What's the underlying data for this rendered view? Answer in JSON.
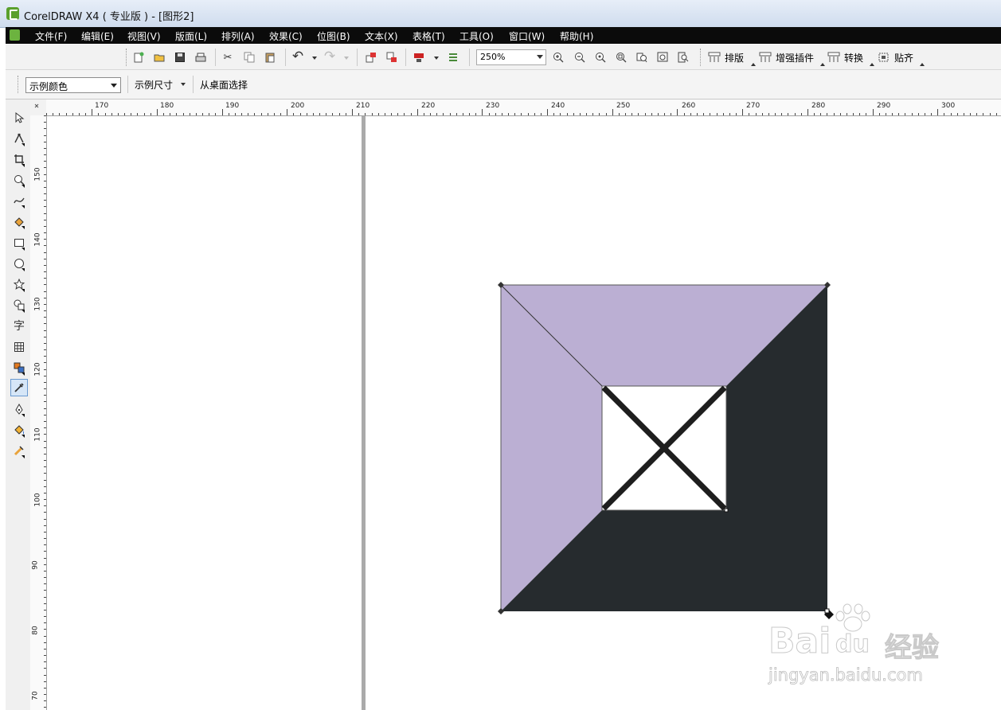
{
  "window": {
    "title": "CorelDRAW X4 ( 专业版 ) - [图形2]"
  },
  "menu": {
    "items": [
      "文件(F)",
      "编辑(E)",
      "视图(V)",
      "版面(L)",
      "排列(A)",
      "效果(C)",
      "位图(B)",
      "文本(X)",
      "表格(T)",
      "工具(O)",
      "窗口(W)",
      "帮助(H)"
    ]
  },
  "toolbar": {
    "zoom": "250%",
    "plugins": [
      "排版",
      "增强插件",
      "转换",
      "贴齐"
    ],
    "icons": [
      "new-icon",
      "open-icon",
      "save-icon",
      "print-icon",
      "cut-icon",
      "copy-icon",
      "paste-icon",
      "undo-icon",
      "redo-icon",
      "import-icon",
      "export-icon",
      "app-launcher-icon",
      "options-icon",
      "zoom-in-icon",
      "zoom-out-icon",
      "zoom-selected-icon",
      "zoom-all-icon",
      "zoom-page-icon",
      "zoom-width-icon",
      "zoom-height-icon"
    ]
  },
  "property_bar": {
    "color_select": "示例颜色",
    "size_label": "示例尺寸",
    "desktop_select": "从桌面选择"
  },
  "toolbox": {
    "tools": [
      "pick-tool-icon",
      "shape-tool-icon",
      "crop-tool-icon",
      "zoom-tool-icon",
      "freehand-tool-icon",
      "smart-fill-icon",
      "rectangle-tool-icon",
      "ellipse-tool-icon",
      "polygon-tool-icon",
      "basic-shapes-icon",
      "text-tool-icon",
      "table-tool-icon",
      "interactive-blend-icon",
      "eyedropper-tool-icon",
      "outline-tool-icon",
      "fill-tool-icon",
      "interactive-fill-icon"
    ],
    "text_tool_glyph": "字",
    "active_tool": "eyedropper-tool-icon"
  },
  "rulers": {
    "horizontal": [
      "170",
      "180",
      "190",
      "200",
      "210",
      "220",
      "230",
      "240",
      "250",
      "260",
      "270",
      "280",
      "290",
      "300"
    ],
    "vertical": [
      "150",
      "140",
      "130",
      "120",
      "110",
      "100",
      "90",
      "80",
      "70"
    ]
  },
  "artwork": {
    "colors": {
      "lavender": "#bbafd3",
      "dark": "#262b2e",
      "stroke": "#1e1e1e",
      "white": "#ffffff"
    }
  },
  "watermark": {
    "brand_left": "Bai",
    "brand_right": "du",
    "brand_cn": "经验",
    "url": "jingyan.baidu.com"
  }
}
